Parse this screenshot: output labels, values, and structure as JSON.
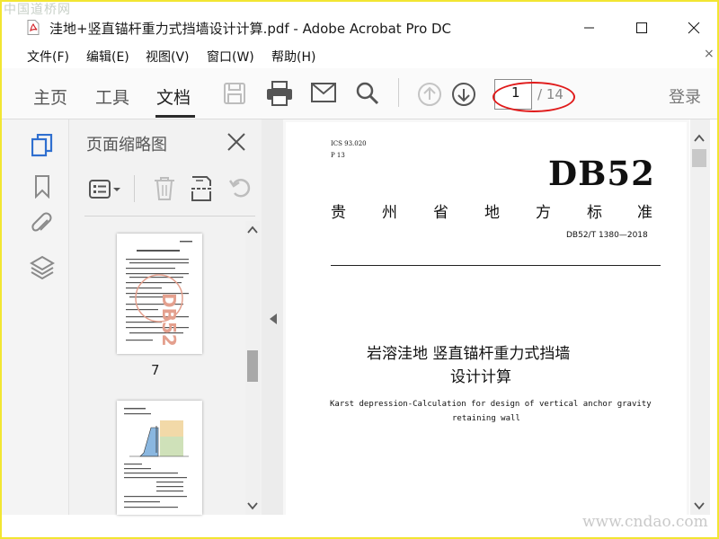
{
  "window": {
    "title": "洼地+竖直锚杆重力式挡墙设计计算.pdf - Adobe Acrobat Pro DC",
    "watermark_top": "中国道桥网",
    "watermark_bottom": "www.cndao.com"
  },
  "menu": {
    "items": [
      "文件(F)",
      "编辑(E)",
      "视图(V)",
      "窗口(W)",
      "帮助(H)"
    ],
    "close_glyph": "×"
  },
  "toolbar": {
    "tabs": [
      "主页",
      "工具",
      "文档"
    ],
    "active_tab": "文档",
    "page_current": "1",
    "page_total": "/ 14",
    "login": "登录",
    "highlight_color": "#e01b1b"
  },
  "thumbnails": {
    "title": "页面缩略图",
    "page_label": "7"
  },
  "document": {
    "ics": "ICS 93.020",
    "p": "P 13",
    "code": "DB52",
    "province": [
      "贵",
      "州",
      "省",
      "地",
      "方",
      "标",
      "准"
    ],
    "std_no": "DB52/T 1380—2018",
    "title_line1": "岩溶洼地 竖直锚杆重力式挡墙",
    "title_line2": "设计计算",
    "en_line1": "Karst depression-Calculation for design of vertical anchor gravity",
    "en_line2": "retaining wall"
  },
  "icons": [
    "pdf-file-icon",
    "minimize-icon",
    "maximize-icon",
    "close-icon",
    "save-icon",
    "print-icon",
    "mail-icon",
    "search-icon",
    "page-up-icon",
    "page-down-icon",
    "pages-icon",
    "bookmark-icon",
    "attachment-icon",
    "layers-icon",
    "options-icon",
    "delete-icon",
    "extract-icon",
    "undo-icon",
    "scroll-up-icon",
    "scroll-down-icon",
    "collapse-left-icon"
  ]
}
